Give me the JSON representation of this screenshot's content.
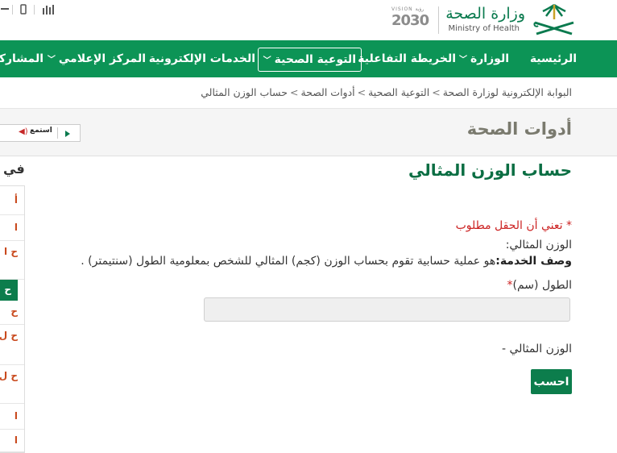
{
  "header": {
    "ministry_ar": "وزارة الصحة",
    "ministry_en": "Ministry of Health",
    "vision_top": "VISION رؤية",
    "vision_year": "2030",
    "logo_icon": "palm-swords-logo-icon",
    "tool_icons": [
      "accessibility-icon",
      "mobile-icon",
      "stats-icon"
    ]
  },
  "nav": {
    "items": [
      {
        "label": "الرئيسية"
      },
      {
        "label": "الوزارة"
      },
      {
        "label": "الخريطة التفاعلية"
      },
      {
        "label": "التوعية الصحية"
      },
      {
        "label": "الخدمات الإلكترونية"
      },
      {
        "label": "المركز الإعلامي"
      },
      {
        "label": "المشاركة"
      }
    ],
    "color": "#0c9456"
  },
  "breadcrumb": {
    "items": [
      "البوابة الإلكترونية لوزارة الصحة",
      "التوعية الصحية",
      "أدوات الصحة",
      "حساب الوزن المثالي"
    ],
    "separator": ">"
  },
  "page": {
    "title": "أدوات الصحة",
    "listen_label": "استمع"
  },
  "form": {
    "title": "حساب الوزن المثالي",
    "required_note": "* تعني أن الحقل مطلوب",
    "service_name": "الوزن المثالي:",
    "service_desc_label": "وصف الخدمة:",
    "service_desc_text": "هو عملية حسابية تقوم بحساب الوزن (كجم) المثالي للشخص بمعلومية الطول (سنتيمتر) .",
    "height_label": "الطول (سم)",
    "height_required_mark": "*",
    "height_value": "",
    "result_label": "الوزن المثالي -",
    "calc_button": "احسب",
    "accent_color": "#0c7d4c",
    "required_color": "#cc2222"
  },
  "sidebar": {
    "heading": "في",
    "items": [
      "أ",
      "ا",
      "ح ا",
      "ح",
      "ح",
      "ح ل",
      "ح ل",
      "ا",
      "ا"
    ]
  }
}
